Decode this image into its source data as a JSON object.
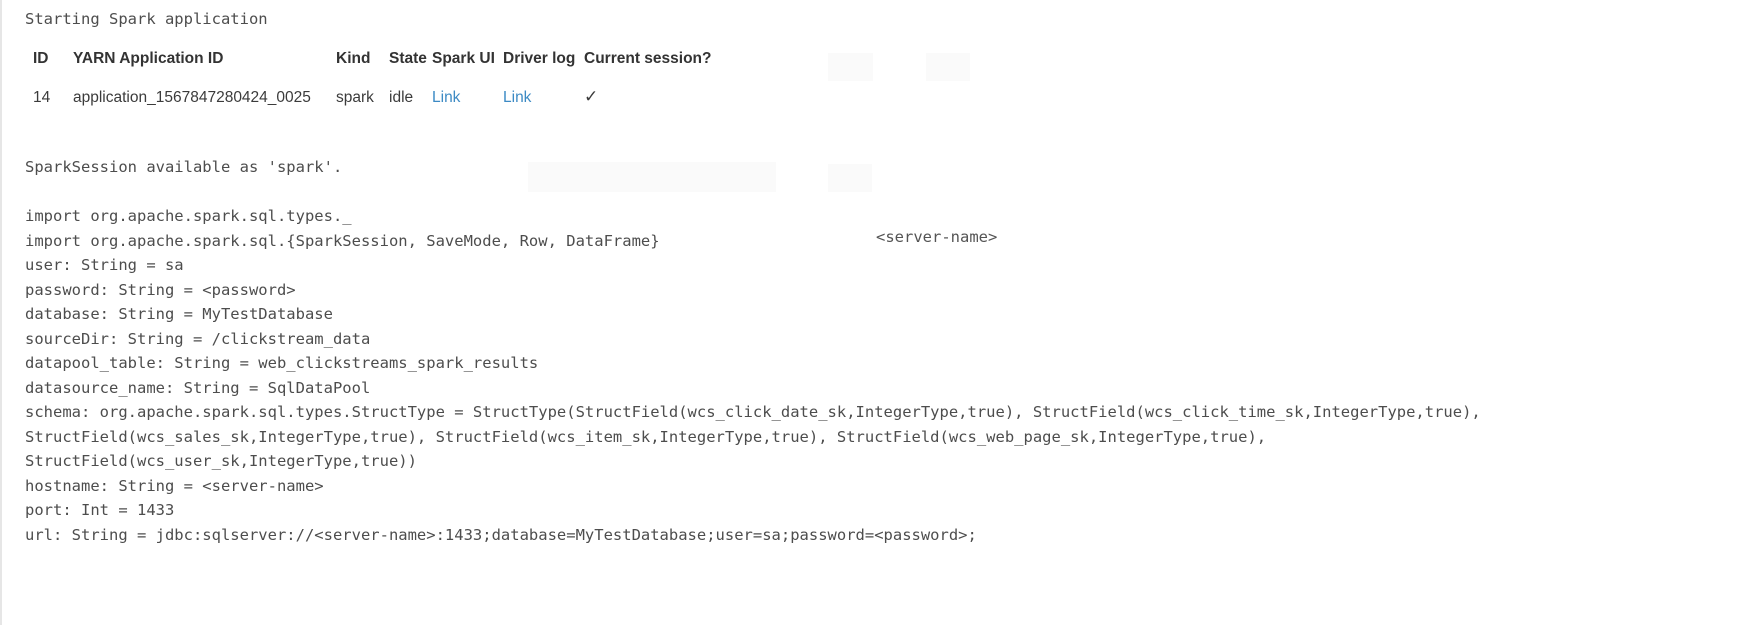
{
  "console": {
    "starting_line": "Starting Spark application"
  },
  "session_table": {
    "headers": [
      "ID",
      "YARN Application ID",
      "Kind",
      "State",
      "Spark UI",
      "Driver log",
      "Current session?"
    ],
    "rows": [
      {
        "id": "14",
        "yarn_application_id": "application_1567847280424_0025",
        "kind": "spark",
        "state": "idle",
        "spark_ui_label": "Link",
        "driver_log_label": "Link",
        "current_session": "✓"
      }
    ]
  },
  "output_lines": [
    "SparkSession available as 'spark'.",
    "",
    "import org.apache.spark.sql.types._",
    "import org.apache.spark.sql.{SparkSession, SaveMode, Row, DataFrame}",
    "user: String = sa",
    "password: String = <password>",
    "database: String = MyTestDatabase",
    "sourceDir: String = /clickstream_data",
    "datapool_table: String = web_clickstreams_spark_results",
    "datasource_name: String = SqlDataPool",
    "schema: org.apache.spark.sql.types.StructType = StructType(StructField(wcs_click_date_sk,IntegerType,true), StructField(wcs_click_time_sk,IntegerType,true),",
    "StructField(wcs_sales_sk,IntegerType,true), StructField(wcs_item_sk,IntegerType,true), StructField(wcs_web_page_sk,IntegerType,true),",
    "StructField(wcs_user_sk,IntegerType,true))",
    "hostname: String = <server-name>",
    "port: Int = 1433",
    "url: String = jdbc:sqlserver://<server-name>:1433;database=MyTestDatabase;user=sa;password=<password>;"
  ],
  "overlay": {
    "server_name_hint": "<server-name>"
  },
  "colors": {
    "link": "#3c8ac4",
    "text": "#4d4d4d",
    "header_text": "#333333",
    "background": "#ffffff",
    "rail": "#e6e6e6"
  }
}
